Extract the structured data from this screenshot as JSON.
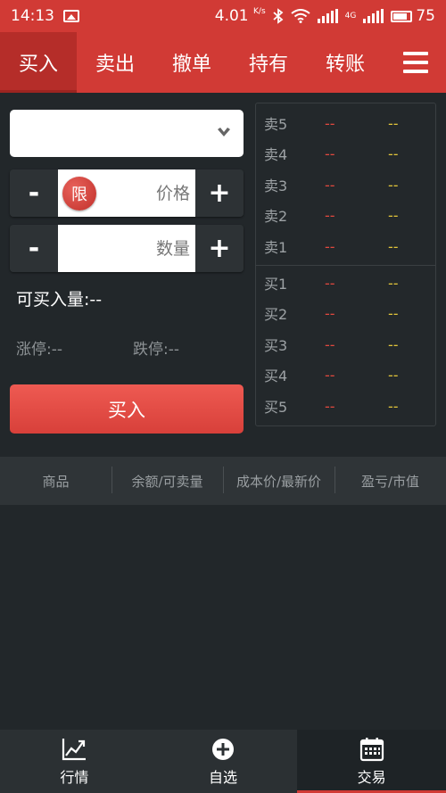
{
  "status_bar": {
    "time": "14:13",
    "speed": "4.01",
    "speed_unit": "K/s",
    "network": "4G",
    "battery": "75",
    "icons": [
      "image-icon",
      "bluetooth-icon",
      "wifi-icon",
      "signal-icon",
      "battery-icon"
    ]
  },
  "tabs": [
    {
      "label": "买入",
      "active": true
    },
    {
      "label": "卖出",
      "active": false
    },
    {
      "label": "撤单",
      "active": false
    },
    {
      "label": "持有",
      "active": false
    },
    {
      "label": "转账",
      "active": false
    }
  ],
  "form": {
    "product_select_value": "",
    "price": {
      "minus": "-",
      "plus": "+",
      "badge": "限",
      "placeholder": "价格",
      "value": ""
    },
    "quantity": {
      "minus": "-",
      "plus": "+",
      "placeholder": "数量",
      "value": ""
    },
    "max_buy": "可买入量:--",
    "limit_up": "涨停:--",
    "limit_down": "跌停:--",
    "submit_label": "买入"
  },
  "order_book": {
    "asks": [
      {
        "label": "卖5",
        "price": "--",
        "volume": "--"
      },
      {
        "label": "卖4",
        "price": "--",
        "volume": "--"
      },
      {
        "label": "卖3",
        "price": "--",
        "volume": "--"
      },
      {
        "label": "卖2",
        "price": "--",
        "volume": "--"
      },
      {
        "label": "卖1",
        "price": "--",
        "volume": "--"
      }
    ],
    "bids": [
      {
        "label": "买1",
        "price": "--",
        "volume": "--"
      },
      {
        "label": "买2",
        "price": "--",
        "volume": "--"
      },
      {
        "label": "买3",
        "price": "--",
        "volume": "--"
      },
      {
        "label": "买4",
        "price": "--",
        "volume": "--"
      },
      {
        "label": "买5",
        "price": "--",
        "volume": "--"
      }
    ]
  },
  "positions": {
    "columns": [
      "商品",
      "余额/可卖量",
      "成本价/最新价",
      "盈亏/市值"
    ]
  },
  "bottom_nav": [
    {
      "label": "行情",
      "icon": "chart-icon",
      "active": false
    },
    {
      "label": "自选",
      "icon": "add-circle-icon",
      "active": false
    },
    {
      "label": "交易",
      "icon": "calendar-icon",
      "active": true
    }
  ],
  "colors": {
    "brand_red": "#d13a35",
    "ask_price": "#e0483f",
    "volume_yellow": "#e0c33a",
    "background": "#22272a"
  }
}
